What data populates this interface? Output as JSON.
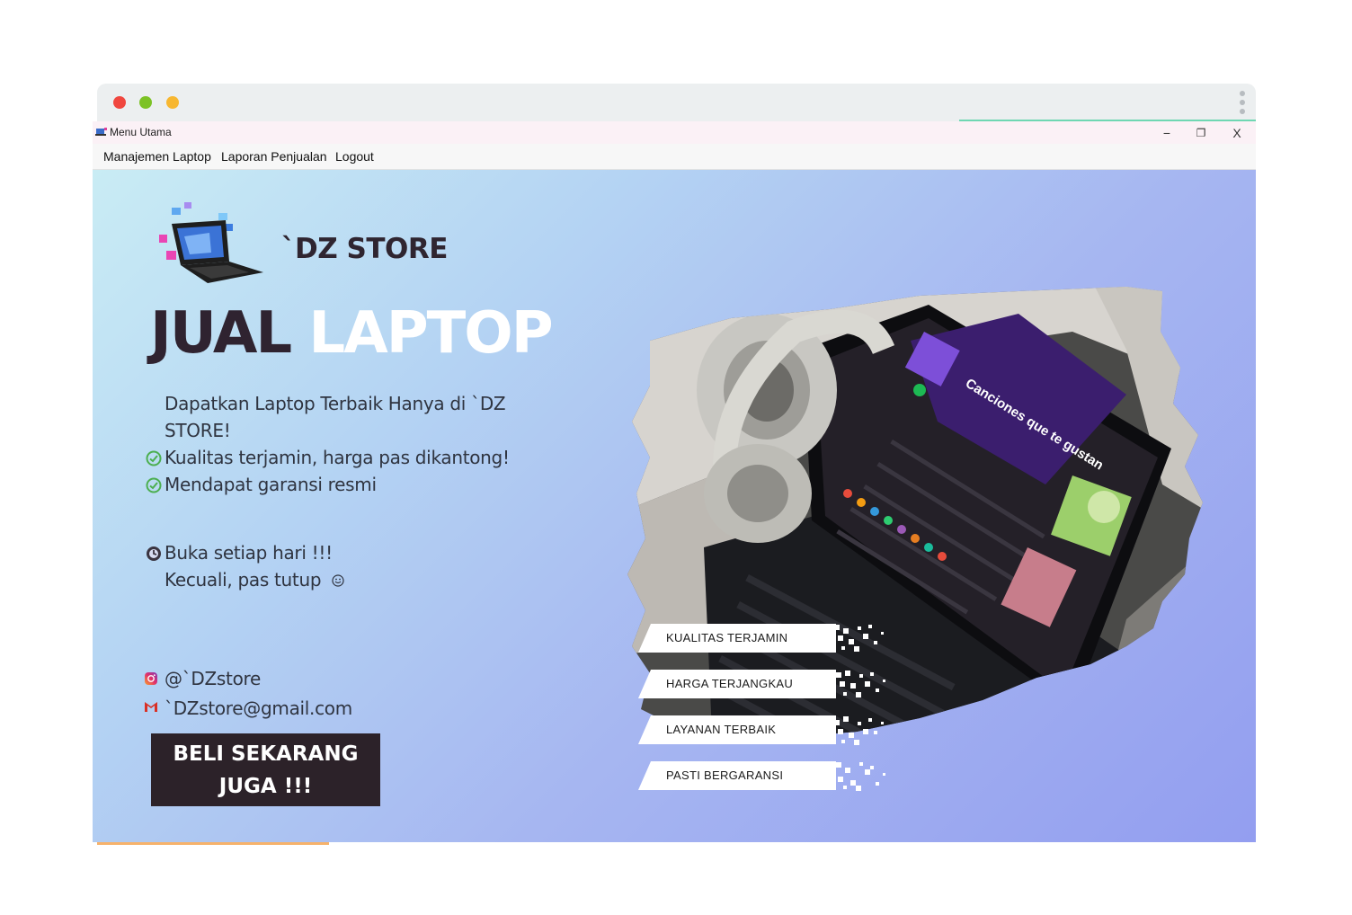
{
  "window": {
    "title": "Menu Utama",
    "controls": {
      "minimize": "−",
      "restore": "❐",
      "close": "X"
    }
  },
  "menu": [
    "Manajemen Laptop",
    "Laporan Penjualan",
    "Logout"
  ],
  "hero": {
    "logo_text": "`DZ STORE",
    "headline_dark": "JUAL",
    "headline_light": "LAPTOP",
    "tagline_line1": "Dapatkan Laptop Terbaik Hanya di `DZ",
    "tagline_line2": "STORE!",
    "features": [
      "Kualitas terjamin, harga pas dikantong!",
      "Mendapat garansi resmi"
    ],
    "hours_line1": "Buka setiap hari !!!",
    "hours_line2": "Kecuali, pas tutup",
    "instagram": "@`DZstore",
    "email": "`DZstore@gmail.com",
    "cta_line1": "BELI SEKARANG",
    "cta_line2": "JUGA !!!"
  },
  "photo": {
    "playlist_title": "Canciones que te gustan"
  },
  "badges": [
    "KUALITAS TERJAMIN",
    "HARGA TERJANGKAU",
    "LAYANAN TERBAIK",
    "PASTI BERGARANSI"
  ],
  "colors": {
    "gradient_start": "#c9ecf4",
    "gradient_end": "#939ef0",
    "headline_dark": "#2f2330",
    "cta_bg": "#2c2229",
    "check_green": "#4caf50"
  },
  "icons": [
    "app-icon",
    "check-circle-icon",
    "clock-icon",
    "smile-icon",
    "instagram-icon",
    "gmail-icon"
  ]
}
